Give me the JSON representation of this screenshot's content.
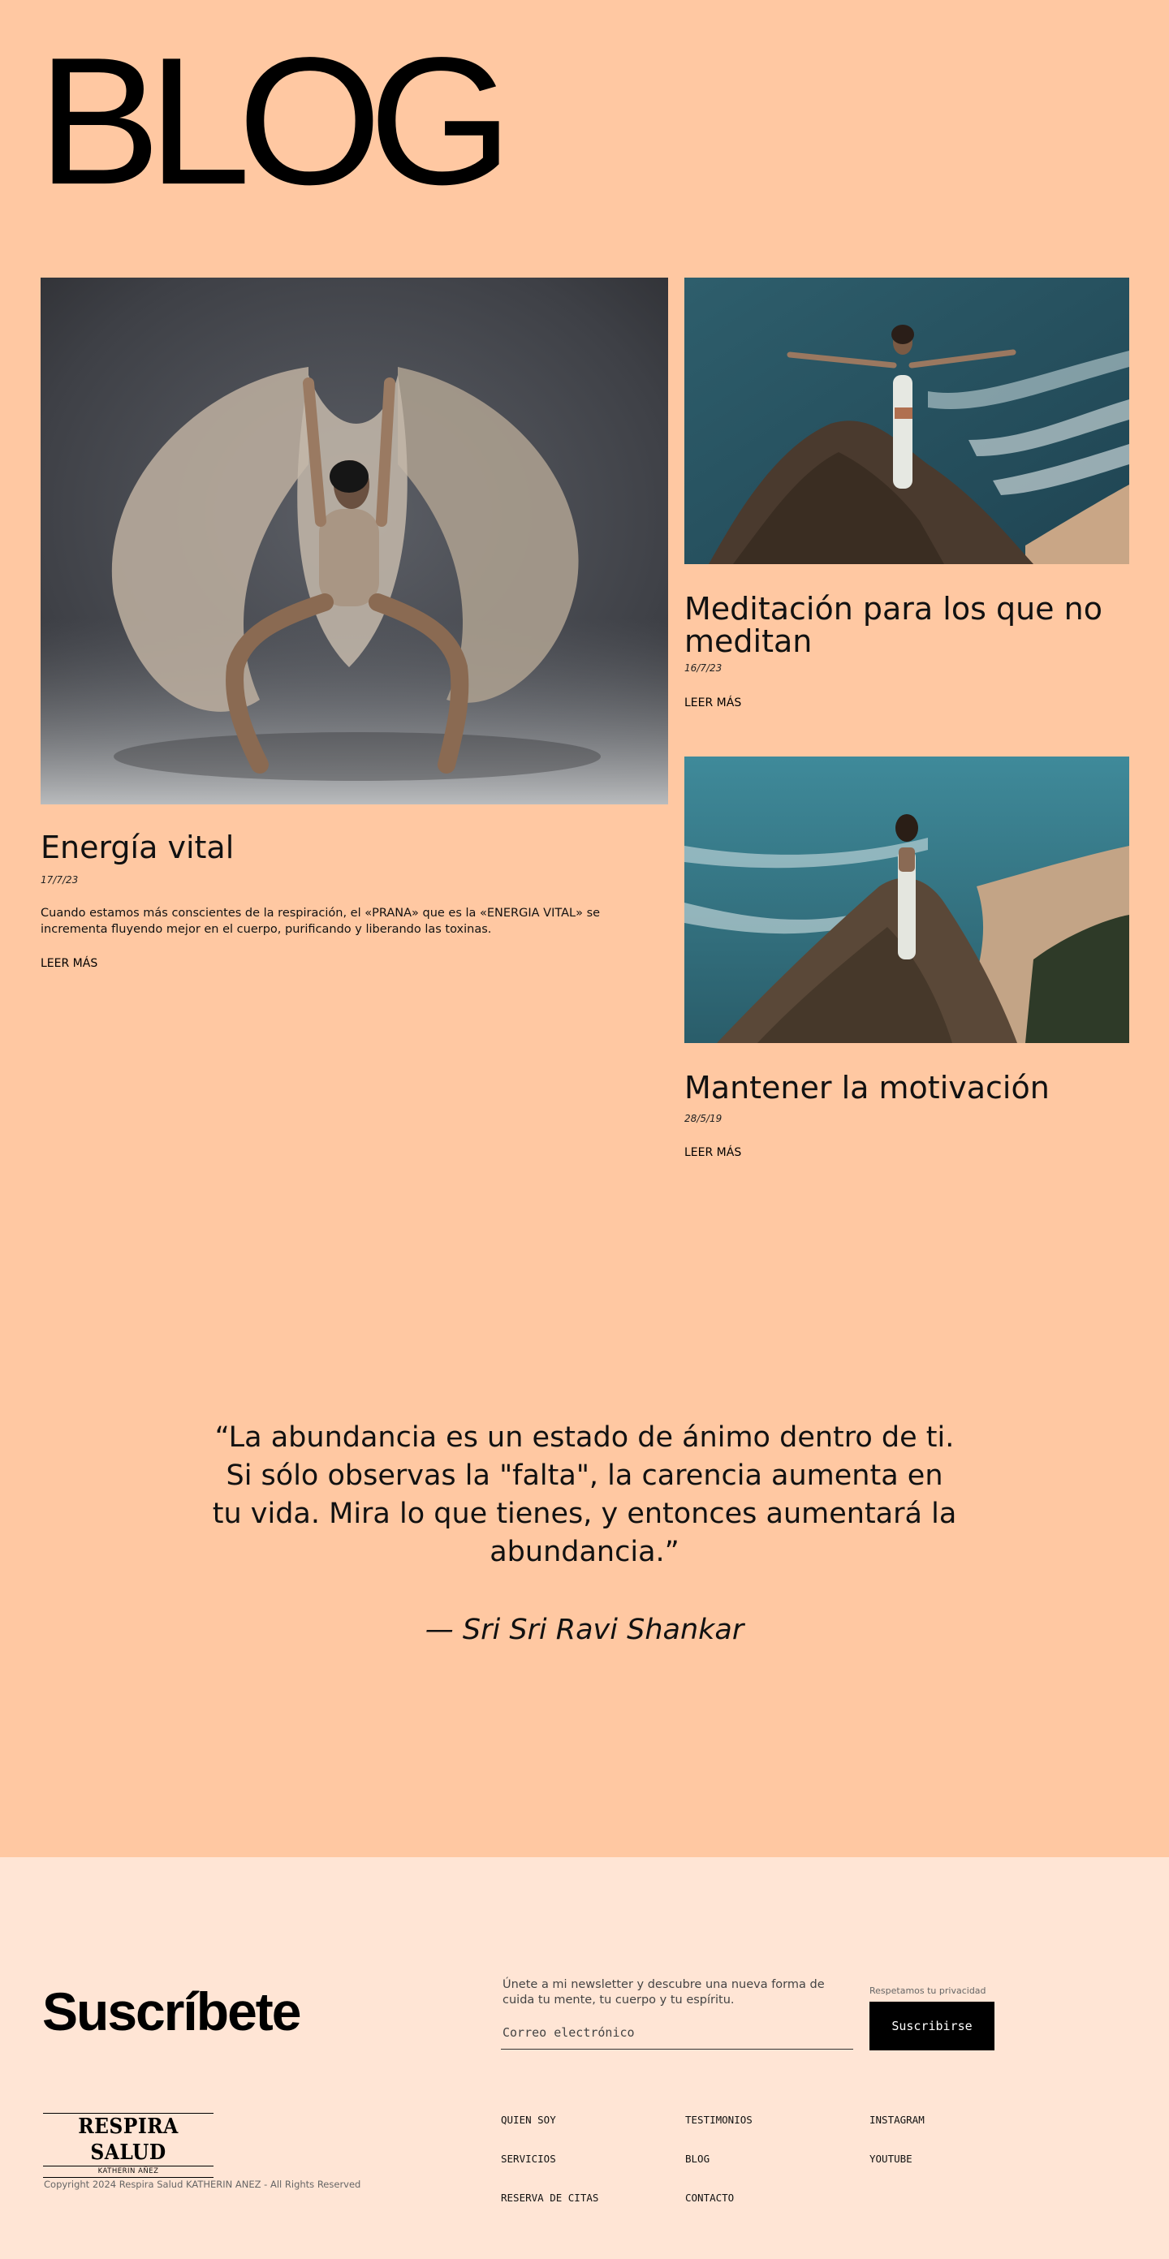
{
  "header": {
    "title": "BLOG"
  },
  "posts": [
    {
      "title": "Energía vital",
      "date": "17/7/23",
      "excerpt": "Cuando estamos más conscientes de la respiración, el «PRANA» que es la «ENERGIA VITAL»  se incrementa fluyendo mejor en el cuerpo,  purificando y liberando las toxinas.",
      "read_more": "LEER MÁS"
    },
    {
      "title": "Meditación para los que no meditan",
      "date": "16/7/23",
      "read_more": "LEER MÁS"
    },
    {
      "title": "Mantener la motivación",
      "date": "28/5/19",
      "read_more": "LEER MÁS"
    }
  ],
  "quote": {
    "text": "“La abundancia es un estado de ánimo dentro de ti. Si sólo observas la \"falta\", la carencia aumenta en tu vida. Mira lo que tienes, y entonces aumentará la abundancia.”",
    "author": "— Sri Sri Ravi Shankar"
  },
  "footer": {
    "subscribe_heading": "Suscríbete",
    "newsletter_text": "Únete a mi newsletter y descubre una nueva forma de cuida tu mente, tu cuerpo y tu espíritu.",
    "email_placeholder": "Correo electrónico",
    "privacy_note": "Respetamos tu privacidad",
    "subscribe_button": "Suscribirse",
    "logo_main": "RESPIRA SALUD",
    "logo_sub": "KATHERIN AÑEZ",
    "copyright": "Copyright 2024 Respira Salud KATHERIN ANEZ - All Rights Reserved",
    "links": {
      "col1": [
        "QUIEN SOY",
        "SERVICIOS",
        "RESERVA DE CITAS"
      ],
      "col2": [
        "TESTIMONIOS",
        "BLOG",
        "CONTACTO"
      ],
      "col3": [
        "INSTAGRAM",
        "YOUTUBE"
      ]
    }
  },
  "colors": {
    "page_background": "#ffc8a2",
    "footer_background": "#ffe5d5",
    "button_background": "#000000"
  }
}
